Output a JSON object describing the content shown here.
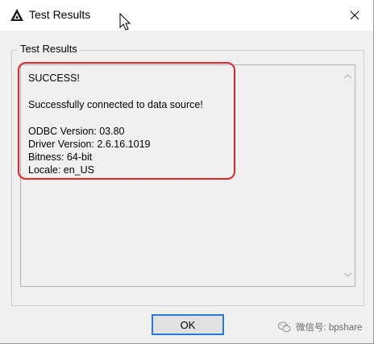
{
  "window": {
    "title": "Test Results",
    "close_label": "✕"
  },
  "group": {
    "label": "Test Results"
  },
  "result_text": {
    "lines": [
      "SUCCESS!",
      "",
      "Successfully connected to data source!",
      "",
      "ODBC Version: 03.80",
      "Driver Version: 2.6.16.1019",
      "Bitness: 64-bit",
      "Locale: en_US"
    ]
  },
  "buttons": {
    "ok_label": "OK"
  },
  "watermark": {
    "text": "微信号: bpshare",
    "icon": "wechat-icon"
  },
  "colors": {
    "highlight": "#e0252b",
    "ok_border": "#2a78d6",
    "dialog_bg": "#f0f0f0"
  }
}
